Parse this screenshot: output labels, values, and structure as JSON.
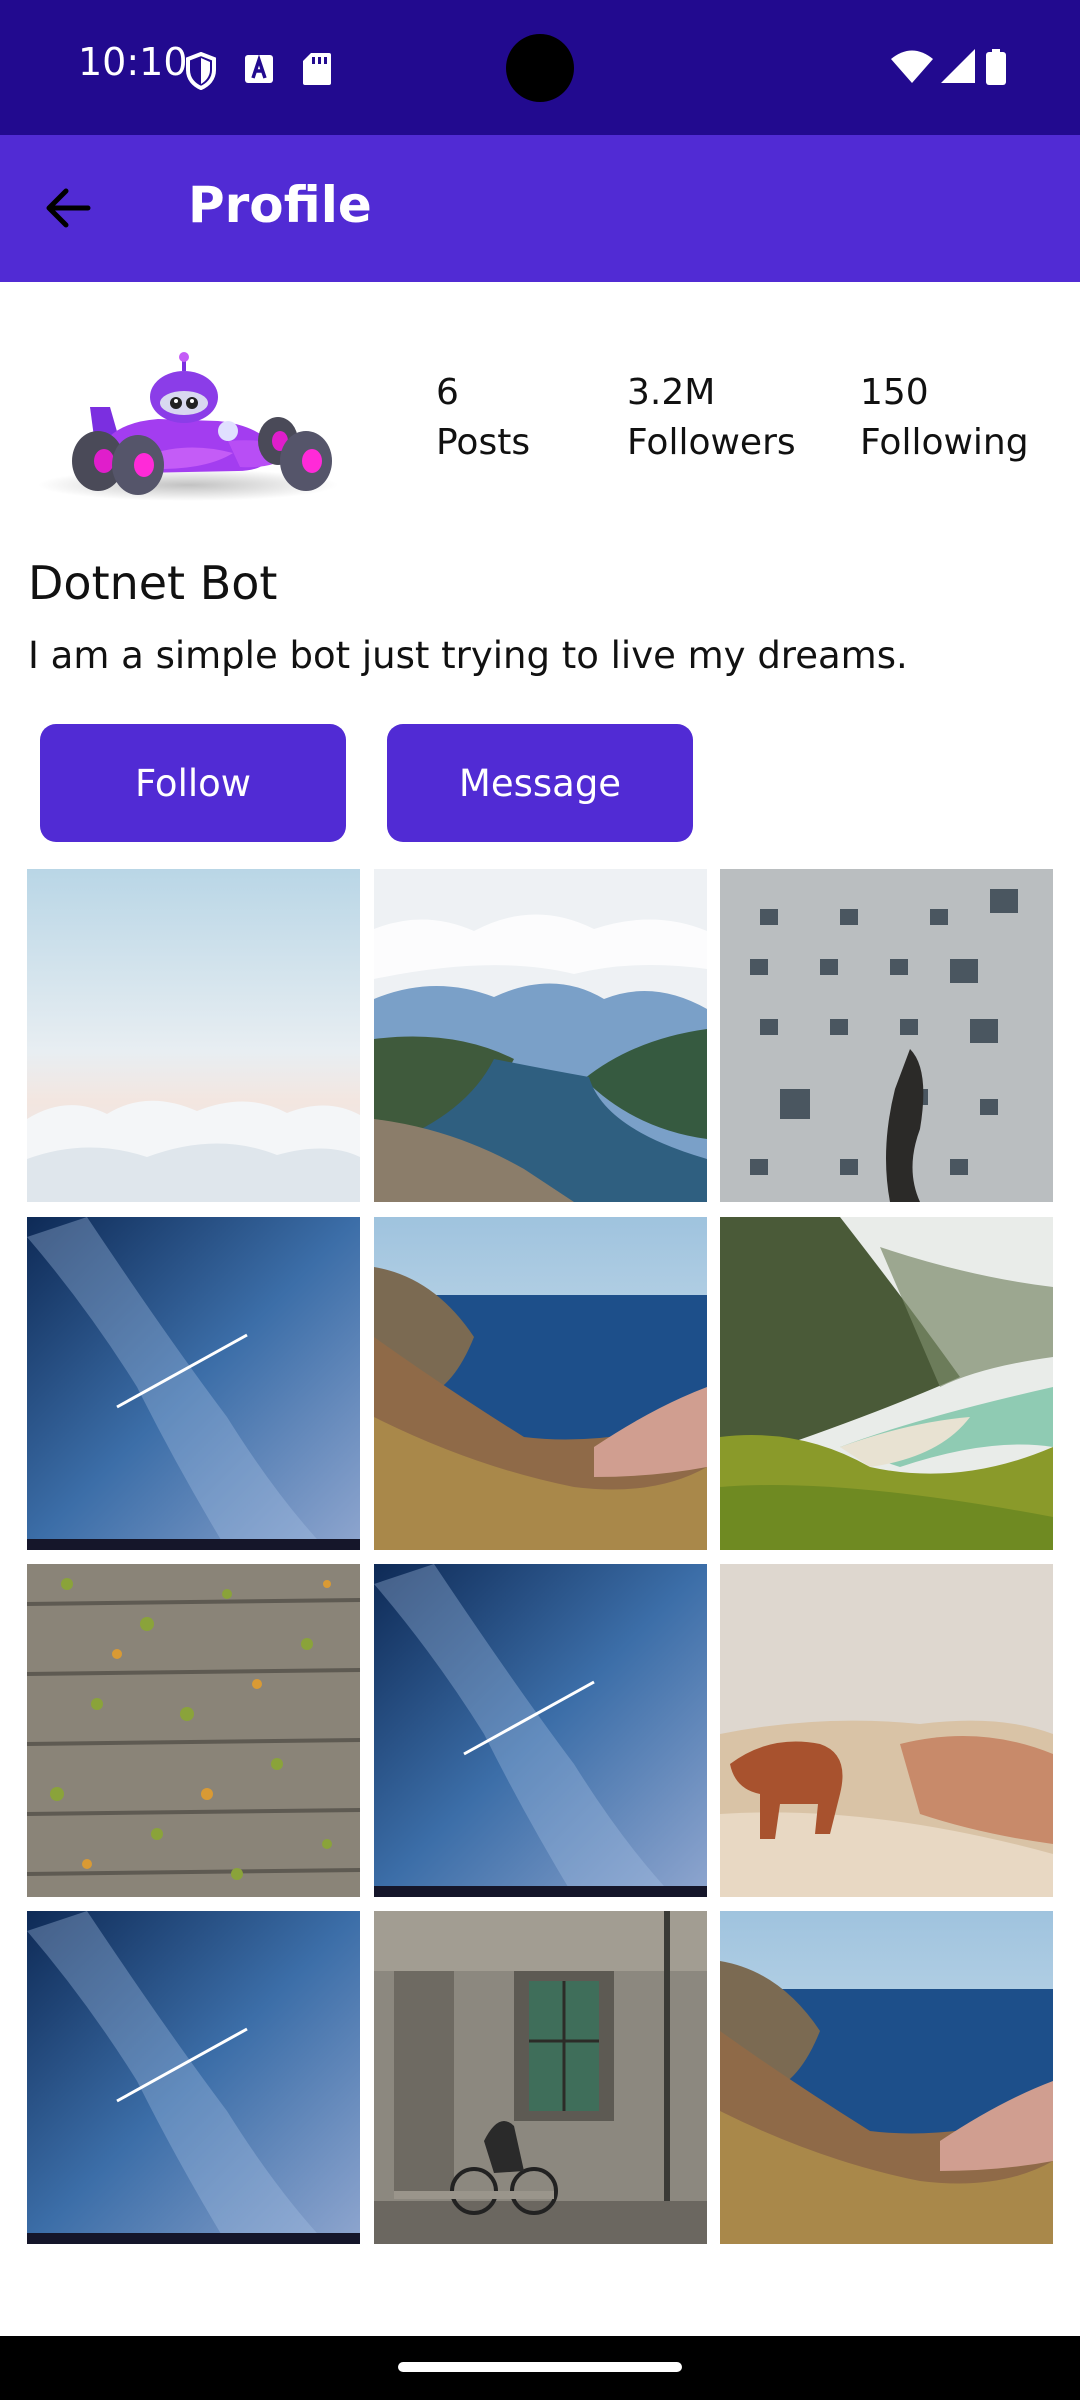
{
  "status_bar": {
    "time": "10:10",
    "left_icons": [
      "shield-icon",
      "font-download-icon",
      "sd-card-icon"
    ],
    "right_icons": [
      "wifi-icon",
      "cellular-signal-icon",
      "battery-icon"
    ]
  },
  "app_bar": {
    "title": "Profile",
    "back_icon": "arrow-left-icon",
    "color": "#512bd4",
    "status_color": "#220a8f"
  },
  "profile": {
    "avatar": "dotnet-bot-race-car",
    "stats": [
      {
        "value": "6",
        "label": "Posts"
      },
      {
        "value": "3.2M",
        "label": "Followers"
      },
      {
        "value": "150",
        "label": "Following"
      }
    ],
    "name": "Dotnet Bot",
    "bio": "I am a simple bot just trying to live my dreams."
  },
  "actions": {
    "follow_label": "Follow",
    "message_label": "Message"
  },
  "gallery": [
    "clouds-sky-photo",
    "fjord-photo",
    "old-building-photo",
    "milky-way-photo",
    "sea-cliff-photo",
    "beach-valley-photo",
    "wood-leaves-photo",
    "milky-way-photo",
    "highland-cow-photo",
    "milky-way-photo",
    "cyclist-street-photo",
    "sea-cliff-photo"
  ]
}
